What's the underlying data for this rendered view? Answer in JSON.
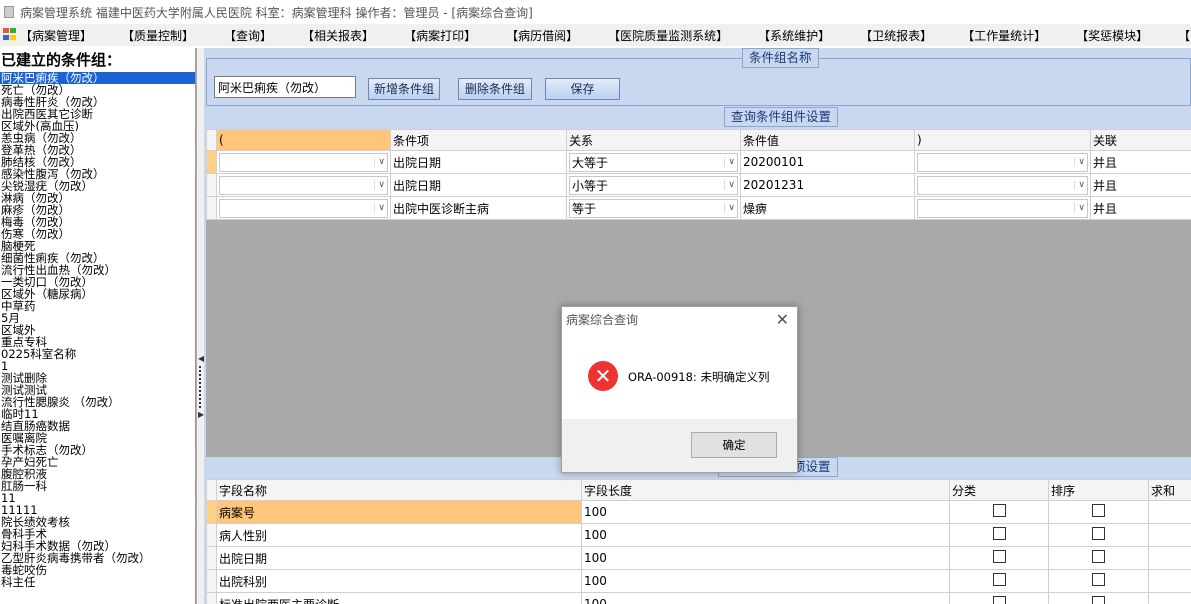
{
  "window": {
    "title": "病案管理系统  福建中医药大学附属人民医院  科室：病案管理科  操作者：管理员 - [病案综合查询]"
  },
  "menu": [
    "【病案管理】",
    "【质量控制】",
    "【查询】",
    "【相关报表】",
    "【病案打印】",
    "【病历借阅】",
    "【医院质量监测系统】",
    "【系统维护】",
    "【卫统报表】",
    "【工作量统计】",
    "【奖惩模块】",
    "【窗口】"
  ],
  "left": {
    "header": "已建立的条件组：",
    "items": [
      "阿米巴痢疾（勿改）",
      "死亡（勿改）",
      "病毒性肝炎（勿改）",
      "出院西医其它诊断",
      "区域外(高血压)",
      "恙虫病（勿改）",
      "登革热（勿改）",
      "肺结核（勿改）",
      "感染性腹泻（勿改）",
      "尖锐湿疣（勿改）",
      "淋病（勿改）",
      "麻疹（勿改）",
      "梅毒（勿改）",
      "伤寒（勿改）",
      "脑梗死",
      "细菌性痢疾（勿改）",
      "流行性出血热（勿改）",
      "一类切口（勿改）",
      "区域外（糖尿病）",
      "中草药",
      "5月",
      "区域外",
      "重点专科",
      "0225科室名称",
      "1",
      "测试删除",
      "测试测试",
      "流行性腮腺炎  （勿改）",
      "临时11",
      "结直肠癌数据",
      "医嘱离院",
      "手术标志（勿改）",
      "孕产妇死亡",
      "腹腔积液",
      "肛肠一科",
      "11",
      "11111",
      "院长绩效考核",
      "骨科手术",
      "妇科手术数据（勿改）",
      "乙型肝炎病毒携带者（勿改）",
      "毒蛇咬伤",
      "科主任"
    ]
  },
  "group_name": {
    "legend": "条件组名称",
    "value": "阿米巴痢疾（勿改）",
    "add_label": "新增条件组",
    "delete_label": "删除条件组",
    "save_label": "保存"
  },
  "conditions": {
    "legend": "查询条件组件设置",
    "headers": [
      "(",
      "条件项",
      "关系",
      "条件值",
      ")",
      "关联"
    ],
    "rows": [
      {
        "open": "",
        "item": "出院日期",
        "relation": "大等于",
        "value": "20200101",
        "close": "",
        "link": "并且"
      },
      {
        "open": "",
        "item": "出院日期",
        "relation": "小等于",
        "value": "20201231",
        "close": "",
        "link": "并且"
      },
      {
        "open": "",
        "item": "出院中医诊断主病",
        "relation": "等于",
        "value": "燥痹",
        "close": "",
        "link": "并且"
      }
    ]
  },
  "fields": {
    "legend": "项设置",
    "headers": [
      "字段名称",
      "字段长度",
      "分类",
      "排序",
      "求和"
    ],
    "rows": [
      {
        "name": "病案号",
        "length": "100"
      },
      {
        "name": "病人性别",
        "length": "100"
      },
      {
        "name": "出院日期",
        "length": "100"
      },
      {
        "name": "出院科别",
        "length": "100"
      },
      {
        "name": "标准出院西医主要诊断",
        "length": "100"
      }
    ]
  },
  "dialog": {
    "title": "病案综合查询",
    "message": "ORA-00918: 未明确定义列",
    "ok_label": "确定",
    "icon": "error-icon"
  },
  "colors": {
    "selection": "#1a63d6",
    "panel": "#c9d8ef",
    "highlight": "#ffc67a",
    "error": "#e33333"
  }
}
